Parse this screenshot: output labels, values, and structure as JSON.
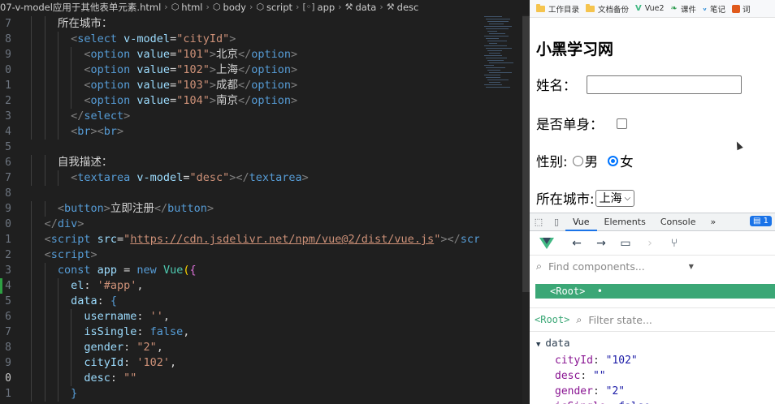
{
  "breadcrumb": {
    "file": "07-v-model应用于其他表单元素.html",
    "items": [
      "html",
      "body",
      "script",
      "app",
      "data",
      "desc"
    ]
  },
  "editor": {
    "line_numbers": [
      "7",
      "8",
      "9",
      "0",
      "1",
      "2",
      "3",
      "4",
      "5",
      "6",
      "7",
      "8",
      "9",
      "0",
      "1",
      "2",
      "3",
      "4",
      "5",
      "6",
      "7",
      "8",
      "9",
      "0",
      "1"
    ],
    "current_line_index": 23,
    "lines": [
      {
        "indent": 4,
        "parts": [
          {
            "c": "tx",
            "t": "所在城市："
          }
        ]
      },
      {
        "indent": 5,
        "parts": [
          {
            "c": "t",
            "t": "<"
          },
          {
            "c": "tg",
            "t": "select"
          },
          {
            "c": "tx",
            "t": " "
          },
          {
            "c": "at",
            "t": "v-model"
          },
          {
            "c": "tx",
            "t": "="
          },
          {
            "c": "st",
            "t": "\"cityId\""
          },
          {
            "c": "t",
            "t": ">"
          }
        ]
      },
      {
        "indent": 6,
        "parts": [
          {
            "c": "t",
            "t": "<"
          },
          {
            "c": "tg",
            "t": "option"
          },
          {
            "c": "tx",
            "t": " "
          },
          {
            "c": "at",
            "t": "value"
          },
          {
            "c": "tx",
            "t": "="
          },
          {
            "c": "st",
            "t": "\"101\""
          },
          {
            "c": "t",
            "t": ">"
          },
          {
            "c": "tx",
            "t": "北京"
          },
          {
            "c": "t",
            "t": "</"
          },
          {
            "c": "tg",
            "t": "option"
          },
          {
            "c": "t",
            "t": ">"
          }
        ]
      },
      {
        "indent": 6,
        "parts": [
          {
            "c": "t",
            "t": "<"
          },
          {
            "c": "tg",
            "t": "option"
          },
          {
            "c": "tx",
            "t": " "
          },
          {
            "c": "at",
            "t": "value"
          },
          {
            "c": "tx",
            "t": "="
          },
          {
            "c": "st",
            "t": "\"102\""
          },
          {
            "c": "t",
            "t": ">"
          },
          {
            "c": "tx",
            "t": "上海"
          },
          {
            "c": "t",
            "t": "</"
          },
          {
            "c": "tg",
            "t": "option"
          },
          {
            "c": "t",
            "t": ">"
          }
        ]
      },
      {
        "indent": 6,
        "parts": [
          {
            "c": "t",
            "t": "<"
          },
          {
            "c": "tg",
            "t": "option"
          },
          {
            "c": "tx",
            "t": " "
          },
          {
            "c": "at",
            "t": "value"
          },
          {
            "c": "tx",
            "t": "="
          },
          {
            "c": "st",
            "t": "\"103\""
          },
          {
            "c": "t",
            "t": ">"
          },
          {
            "c": "tx",
            "t": "成都"
          },
          {
            "c": "t",
            "t": "</"
          },
          {
            "c": "tg",
            "t": "option"
          },
          {
            "c": "t",
            "t": ">"
          }
        ]
      },
      {
        "indent": 6,
        "parts": [
          {
            "c": "t",
            "t": "<"
          },
          {
            "c": "tg",
            "t": "option"
          },
          {
            "c": "tx",
            "t": " "
          },
          {
            "c": "at",
            "t": "value"
          },
          {
            "c": "tx",
            "t": "="
          },
          {
            "c": "st",
            "t": "\"104\""
          },
          {
            "c": "t",
            "t": ">"
          },
          {
            "c": "tx",
            "t": "南京"
          },
          {
            "c": "t",
            "t": "</"
          },
          {
            "c": "tg",
            "t": "option"
          },
          {
            "c": "t",
            "t": ">"
          }
        ]
      },
      {
        "indent": 5,
        "parts": [
          {
            "c": "t",
            "t": "</"
          },
          {
            "c": "tg",
            "t": "select"
          },
          {
            "c": "t",
            "t": ">"
          }
        ]
      },
      {
        "indent": 5,
        "parts": [
          {
            "c": "t",
            "t": "<"
          },
          {
            "c": "tg",
            "t": "br"
          },
          {
            "c": "t",
            "t": ">"
          },
          {
            "c": "t",
            "t": "<"
          },
          {
            "c": "tg",
            "t": "br"
          },
          {
            "c": "t",
            "t": ">"
          }
        ]
      },
      {
        "indent": 0,
        "parts": []
      },
      {
        "indent": 4,
        "parts": [
          {
            "c": "tx",
            "t": "自我描述："
          }
        ]
      },
      {
        "indent": 5,
        "parts": [
          {
            "c": "t",
            "t": "<"
          },
          {
            "c": "tg",
            "t": "textarea"
          },
          {
            "c": "tx",
            "t": " "
          },
          {
            "c": "at",
            "t": "v-model"
          },
          {
            "c": "tx",
            "t": "="
          },
          {
            "c": "st",
            "t": "\"desc\""
          },
          {
            "c": "t",
            "t": "></"
          },
          {
            "c": "tg",
            "t": "textarea"
          },
          {
            "c": "t",
            "t": ">"
          }
        ]
      },
      {
        "indent": 0,
        "parts": []
      },
      {
        "indent": 4,
        "parts": [
          {
            "c": "t",
            "t": "<"
          },
          {
            "c": "tg",
            "t": "button"
          },
          {
            "c": "t",
            "t": ">"
          },
          {
            "c": "tx",
            "t": "立即注册"
          },
          {
            "c": "t",
            "t": "</"
          },
          {
            "c": "tg",
            "t": "button"
          },
          {
            "c": "t",
            "t": ">"
          }
        ]
      },
      {
        "indent": 3,
        "parts": [
          {
            "c": "t",
            "t": "</"
          },
          {
            "c": "tg",
            "t": "div"
          },
          {
            "c": "t",
            "t": ">"
          }
        ]
      },
      {
        "indent": 3,
        "parts": [
          {
            "c": "t",
            "t": "<"
          },
          {
            "c": "tg",
            "t": "script"
          },
          {
            "c": "tx",
            "t": " "
          },
          {
            "c": "at",
            "t": "src"
          },
          {
            "c": "tx",
            "t": "="
          },
          {
            "c": "st",
            "t": "\""
          },
          {
            "c": "url",
            "t": "https://cdn.jsdelivr.net/npm/vue@2/dist/vue.js"
          },
          {
            "c": "st",
            "t": "\""
          },
          {
            "c": "t",
            "t": "></"
          },
          {
            "c": "tg",
            "t": "script"
          },
          {
            "c": "t",
            "t": ">"
          }
        ]
      },
      {
        "indent": 3,
        "parts": [
          {
            "c": "t",
            "t": "<"
          },
          {
            "c": "tg",
            "t": "script"
          },
          {
            "c": "t",
            "t": ">"
          }
        ]
      },
      {
        "indent": 4,
        "parts": [
          {
            "c": "kw",
            "t": "const"
          },
          {
            "c": "tx",
            "t": " "
          },
          {
            "c": "pr",
            "t": "app"
          },
          {
            "c": "tx",
            "t": " = "
          },
          {
            "c": "kw",
            "t": "new"
          },
          {
            "c": "tx",
            "t": " "
          },
          {
            "c": "cls",
            "t": "Vue"
          },
          {
            "c": "br",
            "t": "("
          },
          {
            "c": "br2",
            "t": "{"
          }
        ]
      },
      {
        "indent": 5,
        "parts": [
          {
            "c": "pr",
            "t": "el"
          },
          {
            "c": "tx",
            "t": ": "
          },
          {
            "c": "st",
            "t": "'#app'"
          },
          {
            "c": "tx",
            "t": ","
          }
        ]
      },
      {
        "indent": 5,
        "parts": [
          {
            "c": "pr",
            "t": "data"
          },
          {
            "c": "tx",
            "t": ": "
          },
          {
            "c": "tg",
            "t": "{"
          }
        ]
      },
      {
        "indent": 6,
        "parts": [
          {
            "c": "pr",
            "t": "username"
          },
          {
            "c": "tx",
            "t": ": "
          },
          {
            "c": "st",
            "t": "''"
          },
          {
            "c": "tx",
            "t": ","
          }
        ]
      },
      {
        "indent": 6,
        "parts": [
          {
            "c": "pr",
            "t": "isSingle"
          },
          {
            "c": "tx",
            "t": ": "
          },
          {
            "c": "kw",
            "t": "false"
          },
          {
            "c": "tx",
            "t": ","
          }
        ]
      },
      {
        "indent": 6,
        "parts": [
          {
            "c": "pr",
            "t": "gender"
          },
          {
            "c": "tx",
            "t": ": "
          },
          {
            "c": "st",
            "t": "\"2\""
          },
          {
            "c": "tx",
            "t": ","
          }
        ]
      },
      {
        "indent": 6,
        "parts": [
          {
            "c": "pr",
            "t": "cityId"
          },
          {
            "c": "tx",
            "t": ": "
          },
          {
            "c": "st",
            "t": "'102'"
          },
          {
            "c": "tx",
            "t": ","
          }
        ]
      },
      {
        "indent": 6,
        "parts": [
          {
            "c": "pr",
            "t": "desc"
          },
          {
            "c": "tx",
            "t": ": "
          },
          {
            "c": "st",
            "t": "\"\""
          }
        ]
      },
      {
        "indent": 5,
        "parts": [
          {
            "c": "tg",
            "t": "}"
          }
        ]
      }
    ]
  },
  "bookmarks": [
    {
      "icon": "folder-icon",
      "label": "工作目录"
    },
    {
      "icon": "folder-icon",
      "label": "文档备份"
    },
    {
      "icon": "vue-icon",
      "label": "Vue2"
    },
    {
      "icon": "leaf-icon",
      "label": "课件"
    },
    {
      "icon": "notes-icon",
      "label": "笔记"
    },
    {
      "icon": "app-icon",
      "label": "词"
    }
  ],
  "page": {
    "title": "小黑学习网",
    "name_label": "姓名：",
    "single_label": "是否单身：",
    "gender_label": "性别:",
    "gender_male": "男",
    "gender_female": "女",
    "city_label": "所在城市:",
    "city_selected": "上海"
  },
  "devtools": {
    "tabs": [
      "Vue",
      "Elements",
      "Console"
    ],
    "active_tab": "Vue",
    "more": "»",
    "badge": "1",
    "find_placeholder": "Find components...",
    "root_node": "<Root>  •",
    "state_root": "<Root>",
    "filter_placeholder": "Filter state...",
    "data_section": "data",
    "props": [
      {
        "key": "cityId",
        "value": "\"102\""
      },
      {
        "key": "desc",
        "value": "\"\""
      },
      {
        "key": "gender",
        "value": "\"2\""
      },
      {
        "key": "isSingle",
        "value": "false"
      }
    ]
  },
  "colors": {
    "vue_green": "#41b883",
    "root_highlight": "#3ba776",
    "devtools_active": "#1a73e8"
  }
}
